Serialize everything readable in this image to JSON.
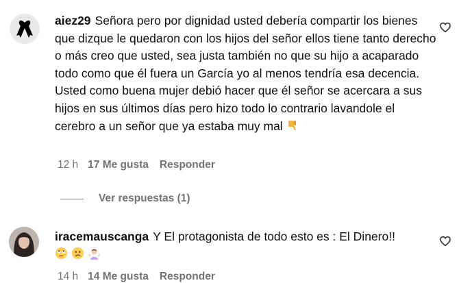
{
  "comments": [
    {
      "username": "aiez29",
      "text": "Señora pero por dignidad usted debería compartir los bienes que dizque le quedaron con los hijos del señor ellos tiene tanto derecho o más creo que usted, sea justa también no que su hijo a acaparado todo como que él fuera un García yo al menos tendría esa decencia. Usted como buena mujer debió hacer que él señor se acercara a sus hijos en sus últimos días pero hizo todo lo contrario lavandole el cerebro a un señor que ya estaba muy mal",
      "emoji_icons": [
        "thumbs-down-icon"
      ],
      "time": "12 h",
      "likes": "17 Me gusta",
      "reply_label": "Responder",
      "view_replies": "Ver respuestas (1)",
      "avatar_icon": "black-ribbon-icon"
    },
    {
      "username": "iracemauscanga",
      "text": "Y El protagonista de todo esto es : El Dinero!!",
      "emoji_icons": [
        "face-with-rolling-eyes-icon",
        "confused-face-icon",
        "person-shrugging-icon"
      ],
      "time": "14 h",
      "likes": "14 Me gusta",
      "reply_label": "Responder",
      "avatar_icon": "profile-photo"
    }
  ],
  "colors": {
    "text": "#111111",
    "meta": "#737373",
    "background": "#ffffff"
  }
}
